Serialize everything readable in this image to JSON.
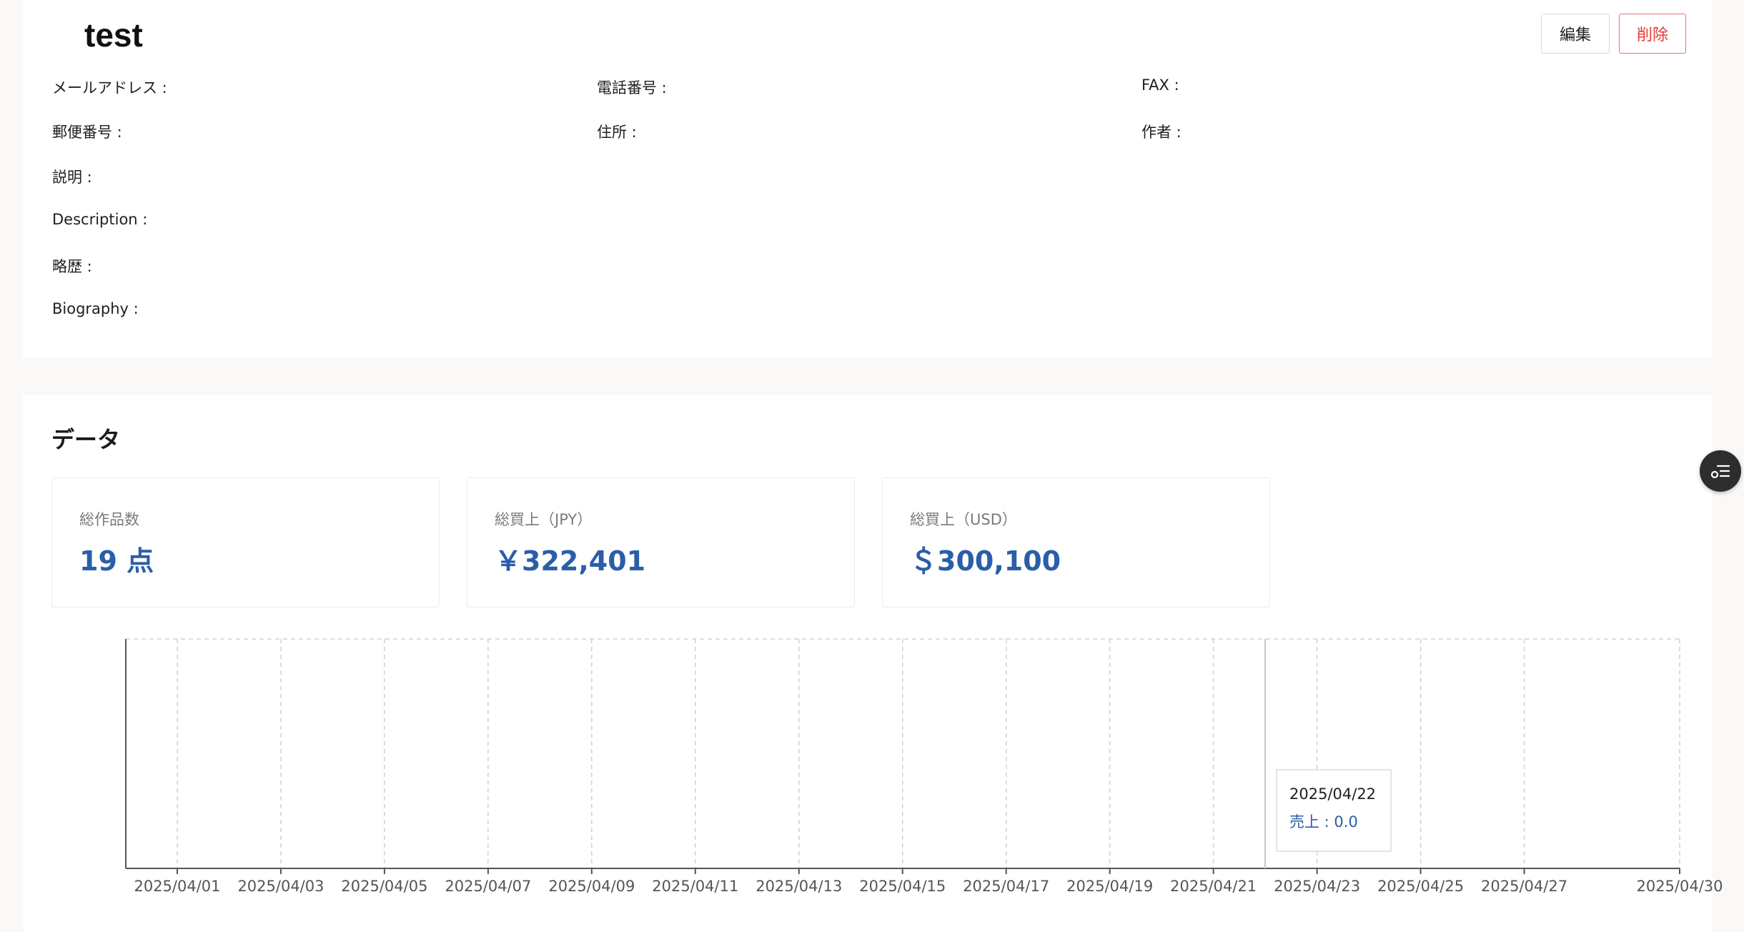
{
  "header": {
    "title": "test",
    "edit_label": "編集",
    "delete_label": "削除"
  },
  "fields": {
    "email": "メールアドレス :",
    "phone": "電話番号 :",
    "fax": "FAX :",
    "postal": "郵便番号 :",
    "address": "住所 :",
    "author": "作者 :",
    "description_ja": "説明 :",
    "description_en": "Description :",
    "biography_ja": "略歴 :",
    "biography_en": "Biography :"
  },
  "data_section": {
    "title": "データ",
    "stats": [
      {
        "label": "総作品数",
        "value": "19 点"
      },
      {
        "label": "総買上（JPY）",
        "value": "￥322,401"
      },
      {
        "label": "総買上（USD）",
        "value": "＄300,100"
      }
    ]
  },
  "tooltip": {
    "date": "2025/04/22",
    "value_text": "売上 : 0.0"
  },
  "fab": {
    "icon": "list-settings-icon"
  },
  "colors": {
    "accent": "#2a5ea8",
    "danger": "#e53935"
  },
  "chart_data": {
    "type": "line",
    "x": [
      "2025/04/01",
      "2025/04/03",
      "2025/04/05",
      "2025/04/07",
      "2025/04/09",
      "2025/04/11",
      "2025/04/13",
      "2025/04/15",
      "2025/04/17",
      "2025/04/19",
      "2025/04/21",
      "2025/04/23",
      "2025/04/25",
      "2025/04/27",
      "2025/04/30"
    ],
    "series": [
      {
        "name": "売上",
        "values": [
          0,
          0,
          0,
          0,
          0,
          0,
          0,
          0,
          0,
          0,
          0,
          0,
          0,
          0,
          0
        ]
      }
    ],
    "grid": true,
    "title": "",
    "xlabel": "",
    "ylabel": ""
  }
}
